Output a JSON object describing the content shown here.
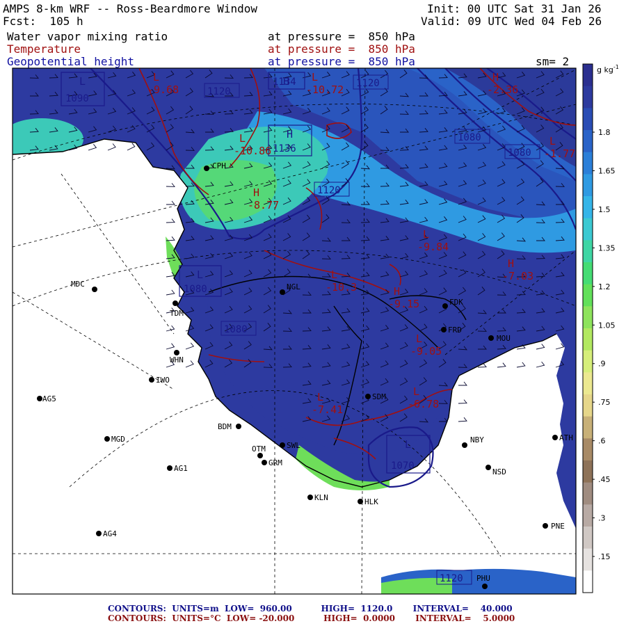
{
  "header": {
    "title": "AMPS 8-km WRF -- Ross-Beardmore Window",
    "forecast": "Fcst:  105 h",
    "init": "Init: 00 UTC Sat 31 Jan 26",
    "valid": "Valid: 09 UTC Wed 04 Feb 26",
    "smoothing": "sm= 2"
  },
  "fields": [
    {
      "name": "Water vapor mixing ratio",
      "level": "at pressure =  850 hPa",
      "color": "#000000"
    },
    {
      "name": "Temperature",
      "level": "at pressure =  850 hPa",
      "color": "#a01010"
    },
    {
      "name": "Geopotential height",
      "level": "at pressure =  850 hPa",
      "color": "#1010a0"
    }
  ],
  "colorbar": {
    "unit": "g kg",
    "unit_exp": "-1",
    "ticks": [
      "1.8",
      "1.65",
      "1.5",
      "1.35",
      "1.2",
      "1.05",
      ".9",
      ".75",
      ".6",
      ".45",
      ".3",
      ".15"
    ],
    "colors": [
      "#2b2f8f",
      "#2d3a9e",
      "#2a4cb4",
      "#2a63c8",
      "#2b7fd8",
      "#2f9ae2",
      "#35b5e8",
      "#3cc9d2",
      "#3fd6a4",
      "#45dc74",
      "#62e05a",
      "#8ee35c",
      "#b2e860",
      "#d6ee7a",
      "#ece890",
      "#e6d68a",
      "#c8b078",
      "#a88a66",
      "#8e7258",
      "#a08c80",
      "#b8aaa4",
      "#d0c8c4",
      "#e6e2e0",
      "#ffffff"
    ]
  },
  "stations": [
    {
      "code": "CPH"
    },
    {
      "code": "MDC"
    },
    {
      "code": "TDM"
    },
    {
      "code": "NGL"
    },
    {
      "code": "WHN"
    },
    {
      "code": "IWO"
    },
    {
      "code": "AG5"
    },
    {
      "code": "BDM"
    },
    {
      "code": "MGD"
    },
    {
      "code": "OTM"
    },
    {
      "code": "SWL"
    },
    {
      "code": "GRM"
    },
    {
      "code": "AG1"
    },
    {
      "code": "KLN"
    },
    {
      "code": "HLK"
    },
    {
      "code": "AG4"
    },
    {
      "code": "SDM"
    },
    {
      "code": "FRD"
    },
    {
      "code": "FDK"
    },
    {
      "code": "MOU"
    },
    {
      "code": "NBY"
    },
    {
      "code": "NSD"
    },
    {
      "code": "PNE"
    },
    {
      "code": "PHU"
    },
    {
      "code": "ATH"
    }
  ],
  "pressure_centers": [
    {
      "type": "L",
      "value": "1090"
    },
    {
      "type": "H",
      "value": "1136"
    },
    {
      "type": "L",
      "value": "1080"
    },
    {
      "type": "L",
      "value": "1070"
    },
    {
      "type": "H",
      "value": "1134"
    }
  ],
  "height_labels": [
    "1120",
    "1120",
    "1080",
    "1080",
    "1120",
    "1120",
    "1080"
  ],
  "temperature_centers": [
    {
      "type": "L",
      "value": "-9.68"
    },
    {
      "type": "L",
      "value": "-10.72"
    },
    {
      "type": "L",
      "value": "-10.86"
    },
    {
      "type": "H",
      "value": "-8.77"
    },
    {
      "type": "L",
      "value": "-9.84"
    },
    {
      "type": "H",
      "value": "-7.03"
    },
    {
      "type": "L",
      "value": "-10.3"
    },
    {
      "type": "H",
      "value": "-9.15"
    },
    {
      "type": "L",
      "value": "-9.05"
    },
    {
      "type": "L",
      "value": "-7.41"
    },
    {
      "type": "L",
      "value": "-6.78"
    },
    {
      "type": "H",
      "value": "-2.36"
    },
    {
      "type": "L",
      "value": "-1.77"
    }
  ],
  "footer": {
    "line1": "CONTOURS:  UNITS=m  LOW=  960.00          HIGH=  1120.0       INTERVAL=    40.000",
    "line2": "CONTOURS:  UNITS=°C  LOW= -20.000          HIGH=  0.0000       INTERVAL=    5.0000",
    "color1": "#10108a",
    "color2": "#8a1010"
  }
}
